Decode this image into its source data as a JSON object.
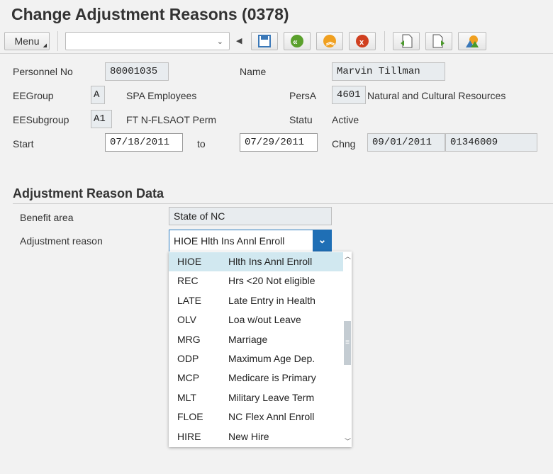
{
  "title": "Change Adjustment Reasons (0378)",
  "toolbar": {
    "menu": "Menu",
    "command_value": "",
    "buttons": [
      "save-icon",
      "back-icon",
      "exit-icon",
      "cancel-icon",
      "previous-record-icon",
      "next-record-icon",
      "overview-icon"
    ]
  },
  "header": {
    "personnel_no_label": "Personnel No",
    "personnel_no": "80001035",
    "name_label": "Name",
    "name": "Marvin Tillman",
    "eegroup_label": "EEGroup",
    "eegroup": "A",
    "eegroup_text": "SPA Employees",
    "persa_label": "PersA",
    "persa": "4601",
    "persa_text": "Natural and Cultural Resources",
    "eesubgroup_label": "EESubgroup",
    "eesubgroup": "A1",
    "eesubgroup_text": "FT N-FLSAOT Perm",
    "status_label": "Statu",
    "status": "Active",
    "start_label": "Start",
    "start": "07/18/2011",
    "to_label": "to",
    "to": "07/29/2011",
    "chng_label": "Chng",
    "chng_date": "09/01/2011",
    "chng_user": "01346009"
  },
  "section": {
    "title": "Adjustment Reason Data",
    "benefit_area_label": "Benefit area",
    "benefit_area": "State of NC",
    "adjustment_reason_label": "Adjustment reason",
    "adjustment_reason": "HIOE Hlth Ins Annl Enroll"
  },
  "dropdown": [
    {
      "code": "HIOE",
      "text": "Hlth Ins Annl Enroll"
    },
    {
      "code": "REC",
      "text": "Hrs <20 Not eligible"
    },
    {
      "code": "LATE",
      "text": "Late Entry in Health"
    },
    {
      "code": "OLV",
      "text": "Loa w/out Leave"
    },
    {
      "code": "MRG",
      "text": "Marriage"
    },
    {
      "code": "ODP",
      "text": "Maximum Age Dep."
    },
    {
      "code": "MCP",
      "text": "Medicare is Primary"
    },
    {
      "code": "MLT",
      "text": "Military Leave Term"
    },
    {
      "code": "FLOE",
      "text": "NC Flex Annl Enroll"
    },
    {
      "code": "HIRE",
      "text": "New Hire"
    }
  ]
}
